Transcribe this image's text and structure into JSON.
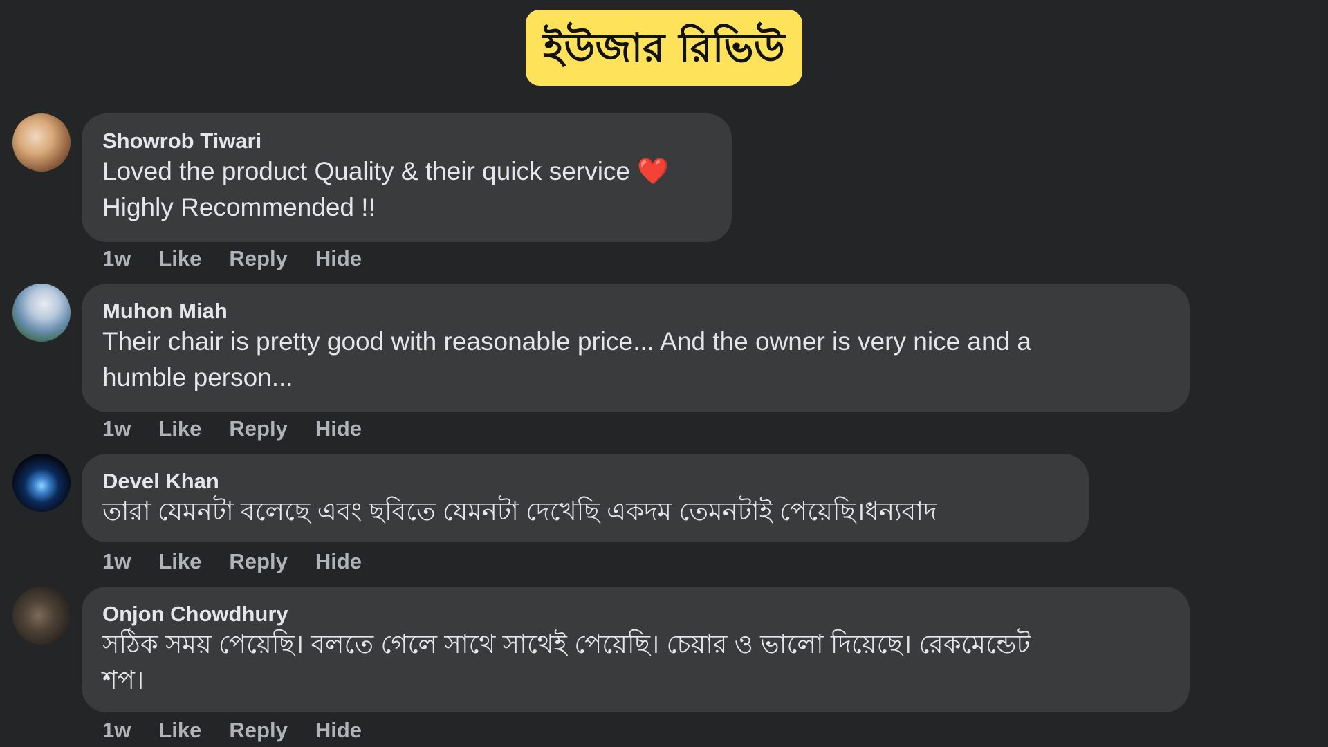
{
  "header": {
    "title": "ইউজার রিভিউ",
    "badge_color": "#fde25a"
  },
  "comments": [
    {
      "author": "Showrob Tiwari",
      "lines": [
        "Loved the product Quality & their quick service",
        "Highly Recommended !!"
      ],
      "emoji": "❤️",
      "time": "1w",
      "like": "Like",
      "reply": "Reply",
      "hide": "Hide"
    },
    {
      "author": "Muhon Miah",
      "lines": [
        "Their chair is pretty good with reasonable price... And the owner is very nice and a",
        "humble person..."
      ],
      "time": "1w",
      "like": "Like",
      "reply": "Reply",
      "hide": "Hide"
    },
    {
      "author": "Devel Khan",
      "lines": [
        "তারা যেমনটা বলেছে এবং ছবিতে যেমনটা দেখেছি একদম তেমনটাই পেয়েছি।ধন্যবাদ"
      ],
      "time": "1w",
      "like": "Like",
      "reply": "Reply",
      "hide": "Hide"
    },
    {
      "author": "Onjon Chowdhury",
      "lines": [
        "সঠিক সময় পেয়েছি। বলতে গেলে সাথে সাথেই পেয়েছি। চেয়ার ও ভালো দিয়েছে। রেকমেন্ডেট",
        "শপ।"
      ],
      "time": "1w",
      "like": "Like",
      "reply": "Reply",
      "hide": "Hide"
    }
  ],
  "colors": {
    "background": "#242526",
    "bubble": "#3a3b3c",
    "text": "#e4e6eb",
    "secondary_text": "#b0b3b8"
  }
}
